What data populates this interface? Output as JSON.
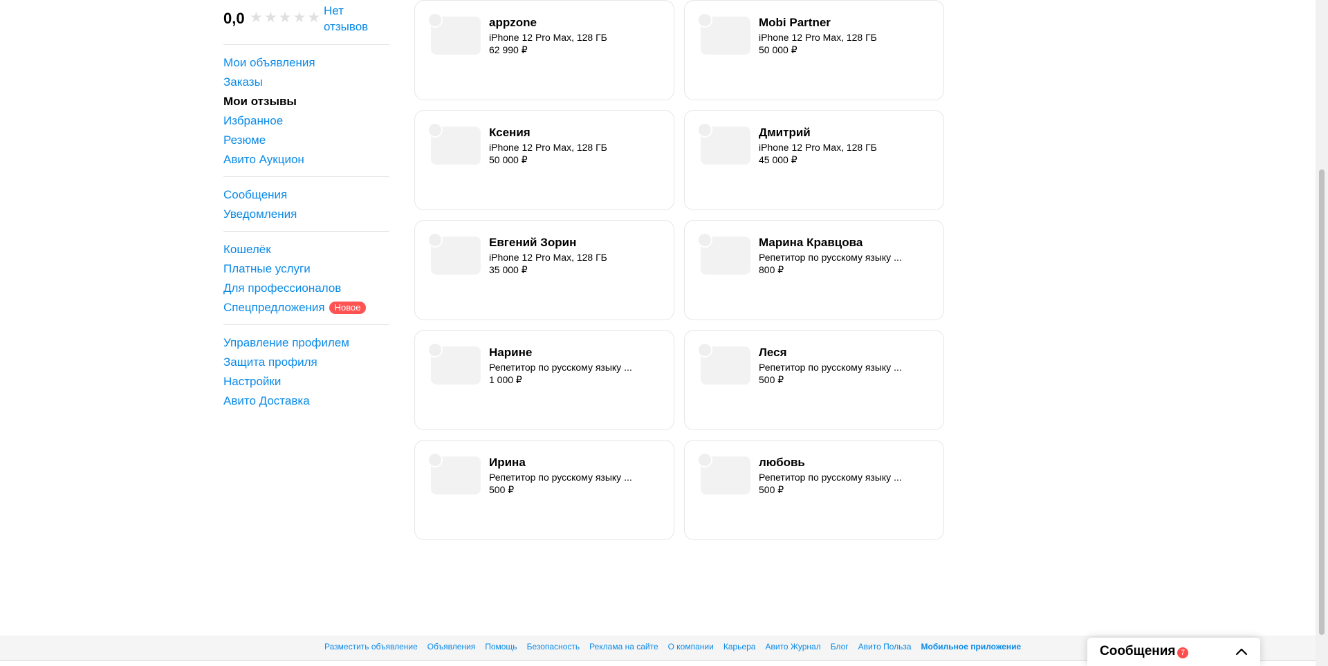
{
  "rating": {
    "value": "0,0",
    "stars": 5,
    "no_reviews": "Нет отзывов"
  },
  "menu": {
    "groups": [
      [
        "Мои объявления",
        "Заказы",
        "Мои отзывы",
        "Избранное",
        "Резюме",
        "Авито Аукцион"
      ],
      [
        "Сообщения",
        "Уведомления"
      ],
      [
        "Кошелёк",
        "Платные услуги",
        "Для профессионалов",
        "Спецпредложения"
      ],
      [
        "Управление профилем",
        "Защита профиля",
        "Настройки",
        "Авито Доставка"
      ]
    ],
    "active": "Мои отзывы",
    "badge_new": "Новое"
  },
  "cards": [
    {
      "name": "appzone",
      "desc": "iPhone 12 Pro Max, 128 ГБ",
      "price": "62 990 ₽"
    },
    {
      "name": "Mobi Partner",
      "desc": "iPhone 12 Pro Max, 128 ГБ",
      "price": "50 000 ₽"
    },
    {
      "name": "Ксения",
      "desc": "iPhone 12 Pro Max, 128 ГБ",
      "price": "50 000 ₽"
    },
    {
      "name": "Дмитрий",
      "desc": "iPhone 12 Pro Max, 128 ГБ",
      "price": "45 000 ₽"
    },
    {
      "name": "Евгений Зорин",
      "desc": "iPhone 12 Pro Max, 128 ГБ",
      "price": "35 000 ₽"
    },
    {
      "name": "Марина Кравцова",
      "desc": "Репетитор по русскому языку ...",
      "price": "800 ₽"
    },
    {
      "name": "Нарине",
      "desc": "Репетитор по русскому языку ...",
      "price": "1 000 ₽"
    },
    {
      "name": "Леся",
      "desc": "Репетитор по русскому языку ...",
      "price": "500 ₽"
    },
    {
      "name": "Ирина",
      "desc": "Репетитор по русскому языку ...",
      "price": "500 ₽"
    },
    {
      "name": "любовь",
      "desc": "Репетитор по русскому языку ...",
      "price": "500 ₽"
    }
  ],
  "footer": {
    "links": [
      "Разместить объявление",
      "Объявления",
      "Помощь",
      "Безопасность",
      "Реклама на сайте",
      "О компании",
      "Карьера",
      "Авито Журнал",
      "Блог",
      "Авито Польза",
      "Мобильное приложение"
    ]
  },
  "messages": {
    "title": "Сообщения",
    "count": "7"
  },
  "colors": {
    "link": "#0a8ae8",
    "badge": "#ff5252"
  }
}
